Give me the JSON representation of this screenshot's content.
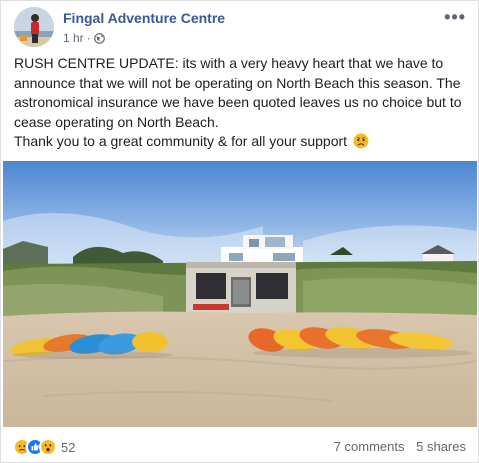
{
  "post": {
    "page_name": "Fingal Adventure Centre",
    "time": "1 hr",
    "audience_icon": "globe-icon",
    "more_icon": "more-options-icon",
    "lines": [
      "RUSH CENTRE UPDATE: its with a very heavy heart that we have to announce that we will not be operating on North Beach this season. The astronomical insurance we have been quoted leaves us no choice but to cease operating on North Beach.",
      "Thank you to a great community & for all your support"
    ],
    "emoji": "sad-face-emoji"
  },
  "photo": {
    "subject": "beach-kayaks-photo"
  },
  "footer": {
    "reaction_icons": [
      "sad-reaction-icon",
      "like-reaction-icon",
      "wow-reaction-icon"
    ],
    "reaction_count": "52",
    "comments": "7 comments",
    "shares": "5 shares"
  },
  "colors": {
    "link": "#385898",
    "meta": "#606770",
    "like": "#1877f2",
    "reaction_yellow": "#f7b928"
  }
}
